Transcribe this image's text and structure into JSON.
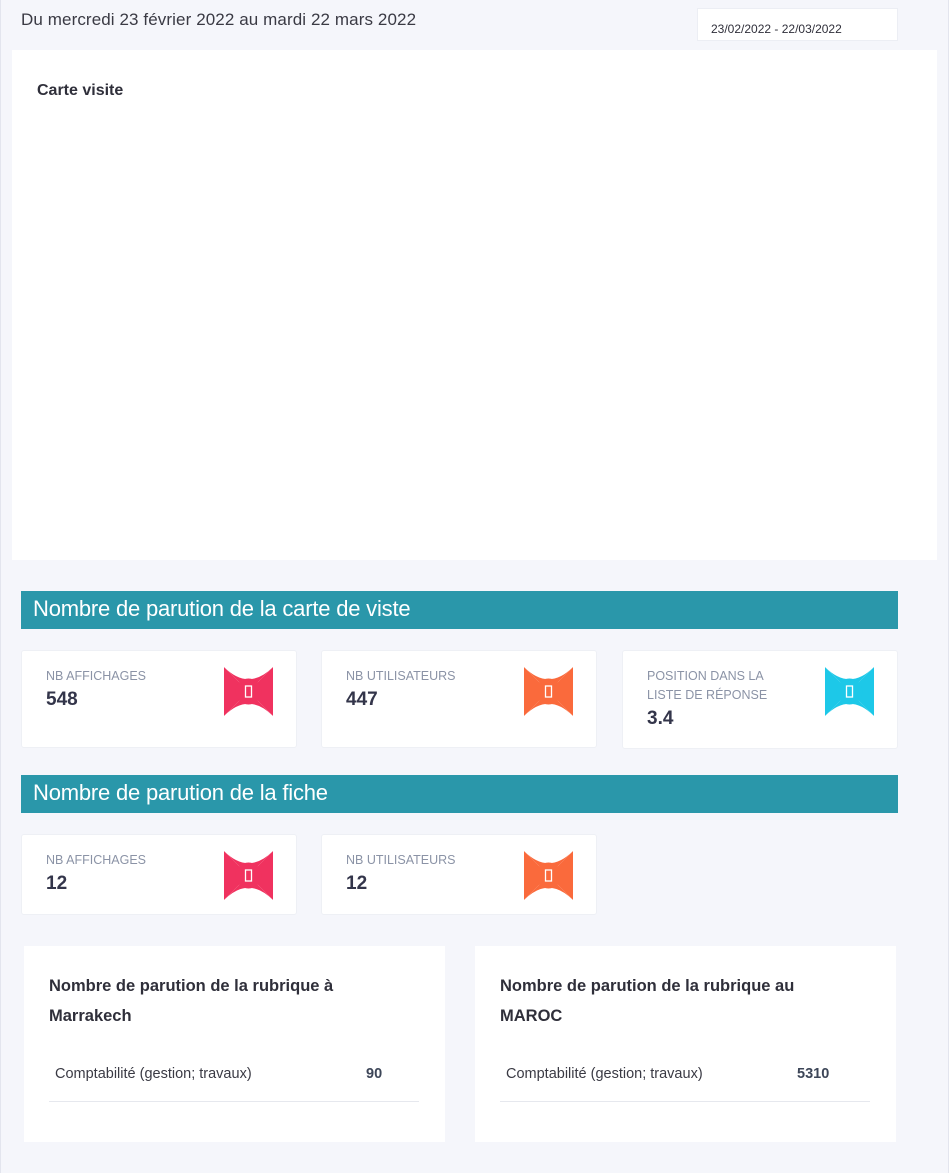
{
  "header": {
    "date_text": "Du mercredi 23 février 2022 au mardi 22 mars 2022",
    "date_range_value": "23/02/2022 - 22/03/2022"
  },
  "map": {
    "title": "Carte visite"
  },
  "section_carte": {
    "title": "Nombre de parution de la carte de viste",
    "stats": [
      {
        "label": "NB AFFICHAGES",
        "value": "548",
        "icon": "eye-icon",
        "color": "#f0325f"
      },
      {
        "label": "NB UTILISATEURS",
        "value": "447",
        "icon": "users-icon",
        "color": "#fa6a3c"
      },
      {
        "label": "POSITION DANS LA LISTE DE RÉPONSE",
        "value": "3.4",
        "icon": "position-icon",
        "color": "#1dc8e8"
      }
    ]
  },
  "section_fiche": {
    "title": "Nombre de parution de la fiche",
    "stats": [
      {
        "label": "NB AFFICHAGES",
        "value": "12",
        "icon": "eye-icon",
        "color": "#f0325f"
      },
      {
        "label": "NB UTILISATEURS",
        "value": "12",
        "icon": "users-icon",
        "color": "#fa6a3c"
      }
    ]
  },
  "rubriques": [
    {
      "title": "Nombre de parution de la rubrique à Marrakech",
      "rows": [
        {
          "name": "Comptabilité (gestion; travaux)",
          "value": "90"
        }
      ]
    },
    {
      "title": "Nombre de parution de la rubrique au MAROC",
      "rows": [
        {
          "name": "Comptabilité (gestion; travaux)",
          "value": "5310"
        }
      ]
    }
  ],
  "colors": {
    "accent_bar": "#2a97aa",
    "pink": "#f0325f",
    "orange": "#fa6a3c",
    "cyan": "#1dc8e8",
    "background": "#f5f6fb"
  }
}
